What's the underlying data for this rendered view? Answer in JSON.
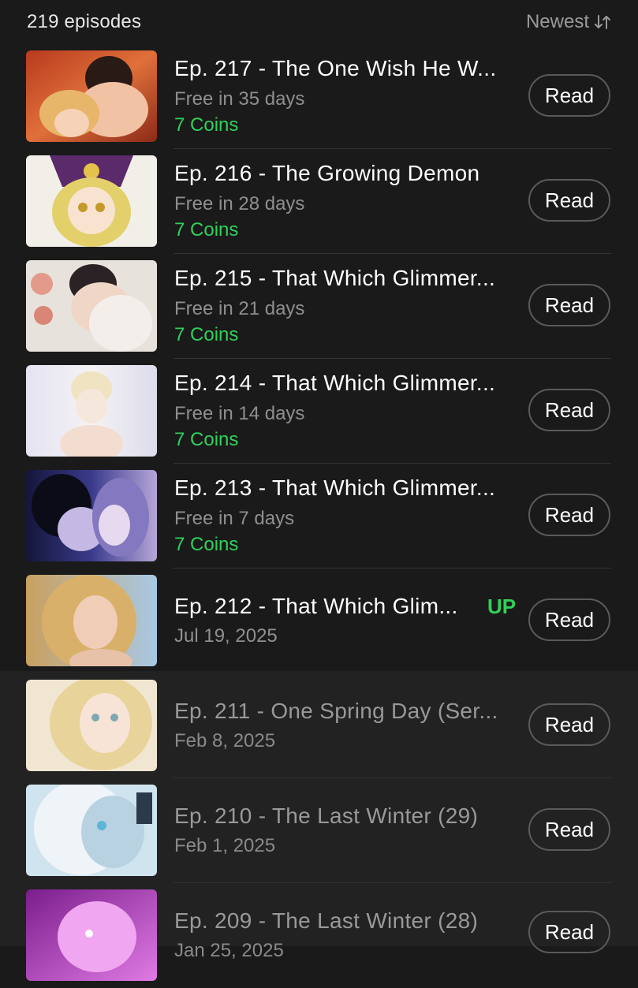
{
  "header": {
    "episode_count": "219 episodes",
    "sort_label": "Newest",
    "sort_icon": "sort-arrows-icon"
  },
  "colors": {
    "background": "#1a1a1a",
    "read_background": "#222222",
    "accent_green": "#2fd15a",
    "muted_text": "#8f8f8f"
  },
  "episodes": [
    {
      "title": "Ep. 217 - The One Wish He W...",
      "status": "Free in 35 days",
      "price": "7 Coins",
      "button": "Read"
    },
    {
      "title": "Ep. 216 - The Growing Demon",
      "status": "Free in 28 days",
      "price": "7 Coins",
      "button": "Read"
    },
    {
      "title": "Ep. 215 - That Which Glimmer...",
      "status": "Free in 21 days",
      "price": "7 Coins",
      "button": "Read"
    },
    {
      "title": "Ep. 214 - That Which Glimmer...",
      "status": "Free in 14 days",
      "price": "7 Coins",
      "button": "Read"
    },
    {
      "title": "Ep. 213 - That Which Glimmer...",
      "status": "Free in 7 days",
      "price": "7 Coins",
      "button": "Read"
    },
    {
      "title": "Ep. 212 - That Which Glim...",
      "date": "Jul 19, 2025",
      "badge": "UP",
      "button": "Read"
    },
    {
      "title": "Ep. 211 - One Spring Day (Ser...",
      "date": "Feb 8, 2025",
      "button": "Read"
    },
    {
      "title": "Ep. 210 - The Last Winter (29)",
      "date": "Feb 1, 2025",
      "button": "Read"
    },
    {
      "title": "Ep. 209 - The Last Winter (28)",
      "date": "Jan 25, 2025",
      "button": "Read"
    }
  ]
}
